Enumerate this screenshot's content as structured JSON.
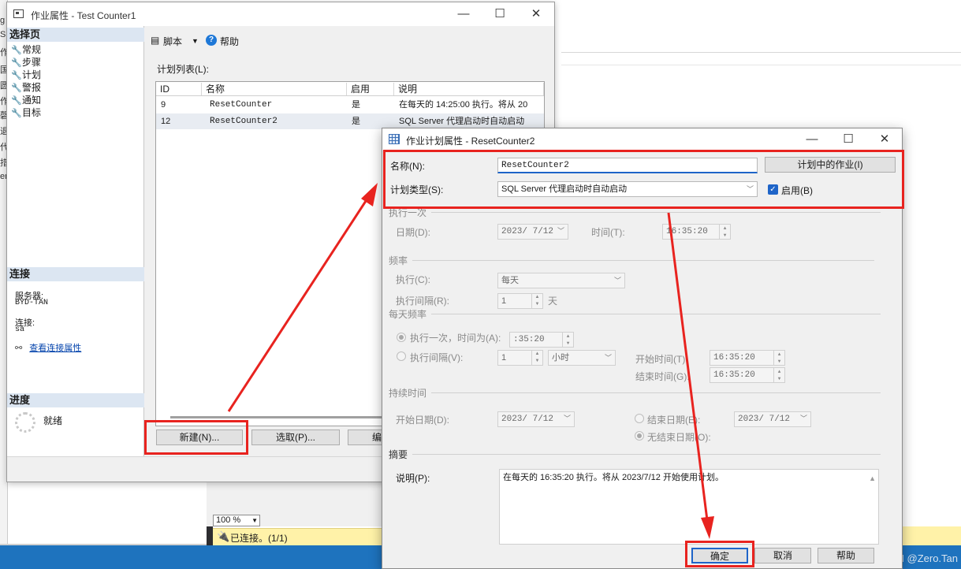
{
  "background": {
    "zoom": "100 %",
    "status": "已连接。(1/1)",
    "left_fragments": [
      "g",
      "S",
      "作",
      "国",
      "圆",
      "作",
      "磬",
      "退",
      "代",
      "措",
      "er"
    ],
    "watermark": "CSDN @Zero.Tan"
  },
  "job_window": {
    "title": "作业属性 - Test Counter1",
    "sidebar": {
      "select_page_header": "选择页",
      "pages": [
        "常规",
        "步骤",
        "计划",
        "警报",
        "通知",
        "目标"
      ],
      "connection_header": "连接",
      "server_label": "服务器:",
      "server_value": "BYD-TAN",
      "connection_label": "连接:",
      "connection_value": "sa",
      "view_connection_link": "查看连接属性",
      "progress_header": "进度",
      "progress_status": "就绪"
    },
    "toolbar": {
      "script_label": "脚本",
      "help_label": "帮助"
    },
    "list_label": "计划列表(L):",
    "grid": {
      "columns": [
        "ID",
        "名称",
        "启用",
        "说明"
      ],
      "rows": [
        {
          "id": "9",
          "name": "ResetCounter",
          "enabled": "是",
          "description": "在每天的 14:25:00 执行。将从 20"
        },
        {
          "id": "12",
          "name": "ResetCounter2",
          "enabled": "是",
          "description": "SQL Server 代理启动时自动启动"
        }
      ]
    },
    "buttons": {
      "new": "新建(N)...",
      "pick": "选取(P)...",
      "edit": "编"
    }
  },
  "schedule_window": {
    "title": "作业计划属性 - ResetCounter2",
    "name_label": "名称(N):",
    "name_value": "ResetCounter2",
    "jobs_button": "计划中的作业(I)",
    "type_label": "计划类型(S):",
    "type_value": "SQL Server 代理启动时自动启动",
    "enabled_label": "启用(B)",
    "once": {
      "section": "执行一次",
      "date_label": "日期(D):",
      "date_value": "2023/ 7/12",
      "time_label": "时间(T):",
      "time_value": "16:35:20"
    },
    "frequency": {
      "section": "频率",
      "occurs_label": "执行(C):",
      "occurs_value": "每天",
      "recur_label": "执行间隔(R):",
      "recur_value": "1",
      "recur_unit": "天"
    },
    "daily": {
      "section": "每天频率",
      "once_at_label": "执行一次，时间为(A):",
      "once_at_value": ":35:20",
      "every_label": "执行间隔(V):",
      "every_value": "1",
      "every_unit": "小时",
      "start_label": "开始时间(T):",
      "start_value": "16:35:20",
      "end_label": "结束时间(G):",
      "end_value": "16:35:20"
    },
    "duration": {
      "section": "持续时间",
      "start_date_label": "开始日期(D):",
      "start_date_value": "2023/ 7/12",
      "end_date_label": "结束日期(E):",
      "end_date_value": "2023/ 7/12",
      "no_end_label": "无结束日期(O):"
    },
    "summary": {
      "section": "摘要",
      "description_label": "说明(P):",
      "description_value": "在每天的 16:35:20 执行。将从 2023/7/12 开始使用计划。"
    },
    "buttons": {
      "ok": "确定",
      "cancel": "取消",
      "help": "帮助"
    }
  },
  "colors": {
    "annotation_red": "#e8231f",
    "taskbar_blue": "#1e73be",
    "status_yellow": "#fff2a8",
    "accent_blue": "#1e64c8"
  }
}
